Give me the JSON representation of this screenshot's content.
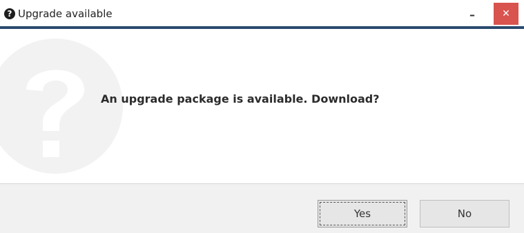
{
  "window": {
    "title": "Upgrade available",
    "title_icon": "question-circle-icon",
    "minimize_glyph": "–",
    "close_glyph": "✕",
    "accent_color": "#2a4a6e",
    "close_color": "#d9534f"
  },
  "dialog": {
    "background_icon": "question-mark-icon",
    "message": "An upgrade package is available. Download?"
  },
  "buttons": {
    "yes_label": "Yes",
    "no_label": "No"
  }
}
